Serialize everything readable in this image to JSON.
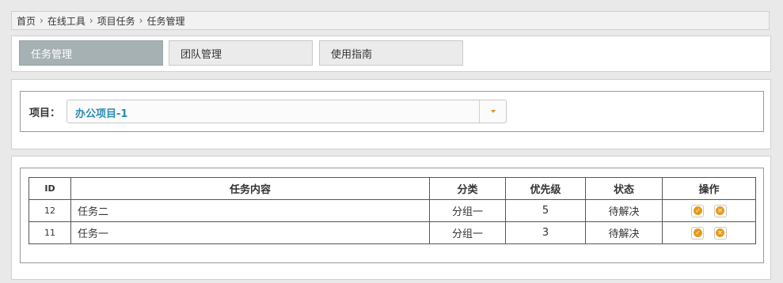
{
  "breadcrumb": {
    "items": [
      "首页",
      "在线工具",
      "项目任务",
      "任务管理"
    ],
    "separator": "›"
  },
  "tabs": [
    {
      "label": "任务管理",
      "active": true
    },
    {
      "label": "团队管理",
      "active": false
    },
    {
      "label": "使用指南",
      "active": false
    }
  ],
  "project": {
    "label": "项目：",
    "selected": "办公项目-1"
  },
  "table": {
    "headers": {
      "id": "ID",
      "content": "任务内容",
      "category": "分类",
      "priority": "优先级",
      "status": "状态",
      "actions": "操作"
    },
    "rows": [
      {
        "id": "12",
        "content": "任务二",
        "category": "分组一",
        "priority": "5",
        "status": "待解决"
      },
      {
        "id": "11",
        "content": "任务一",
        "category": "分组一",
        "priority": "3",
        "status": "待解决"
      }
    ]
  },
  "icons": {
    "complete": "check-circle-icon",
    "delete": "close-circle-icon"
  },
  "colors": {
    "accent": "#e59a1b",
    "active_tab": "#a6b1b4",
    "project_value": "#2b8bb3"
  }
}
